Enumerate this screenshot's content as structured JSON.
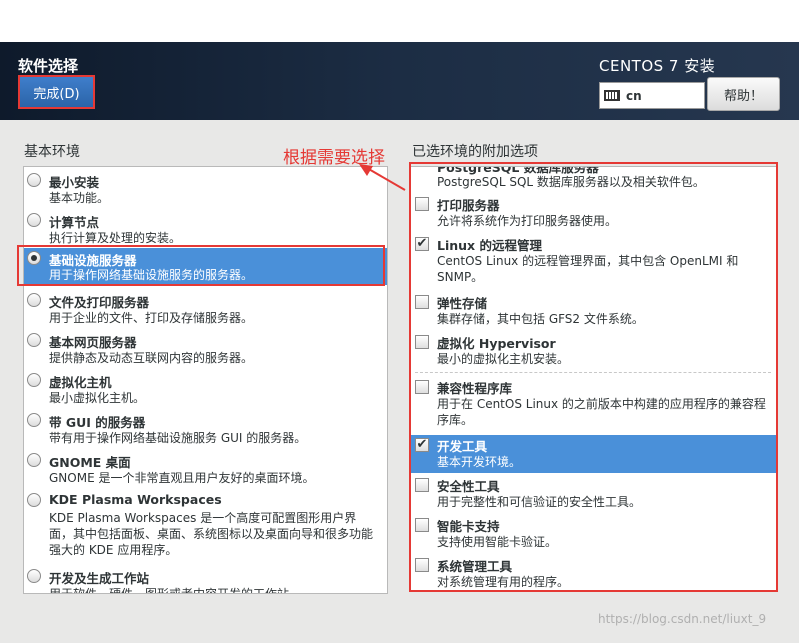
{
  "header": {
    "title": "软件选择",
    "done_label": "完成(D)",
    "product_title": "CENTOS 7 安装",
    "keyboard_layout": "cn",
    "help_label": "帮助！"
  },
  "left": {
    "label": "基本环境",
    "items": [
      {
        "name": "最小安装",
        "desc": "基本功能。",
        "selected": false
      },
      {
        "name": "计算节点",
        "desc": "执行计算及处理的安装。",
        "selected": false
      },
      {
        "name": "基础设施服务器",
        "desc": "用于操作网络基础设施服务的服务器。",
        "selected": true
      },
      {
        "name": "文件及打印服务器",
        "desc": "用于企业的文件、打印及存储服务器。",
        "selected": false
      },
      {
        "name": "基本网页服务器",
        "desc": "提供静态及动态互联网内容的服务器。",
        "selected": false
      },
      {
        "name": "虚拟化主机",
        "desc": "最小虚拟化主机。",
        "selected": false
      },
      {
        "name": "带 GUI 的服务器",
        "desc": "带有用于操作网络基础设施服务 GUI 的服务器。",
        "selected": false
      },
      {
        "name": "GNOME 桌面",
        "desc": "GNOME 是一个非常直观且用户友好的桌面环境。",
        "selected": false
      },
      {
        "name": "KDE Plasma Workspaces",
        "desc": "KDE Plasma Workspaces 是一个高度可配置图形用户界面，其中包括面板、桌面、系统图标以及桌面向导和很多功能强大的 KDE 应用程序。",
        "selected": false
      },
      {
        "name": "开发及生成工作站",
        "desc": "用于软件、硬件、图形或者内容开发的工作站。",
        "selected": false
      }
    ]
  },
  "right": {
    "label": "已选环境的附加选项",
    "cut_name": "PostgreSQL 数据库服务器",
    "cut_desc": "PostgreSQL SQL 数据库服务器以及相关软件包。",
    "items": [
      {
        "name": "打印服务器",
        "desc": "允许将系统作为打印服务器使用。",
        "checked": false,
        "selected": false
      },
      {
        "name": "Linux 的远程管理",
        "desc": "CentOS Linux 的远程管理界面，其中包含 OpenLMI 和 SNMP。",
        "checked": true,
        "selected": false
      },
      {
        "name": "弹性存储",
        "desc": "集群存储，其中包括 GFS2 文件系统。",
        "checked": false,
        "selected": false
      },
      {
        "name": "虚拟化 Hypervisor",
        "desc": "最小的虚拟化主机安装。",
        "checked": false,
        "selected": false
      },
      {
        "name": "兼容性程序库",
        "desc": "用于在 CentOS Linux 的之前版本中构建的应用程序的兼容程序库。",
        "checked": false,
        "selected": false
      },
      {
        "name": "开发工具",
        "desc": "基本开发环境。",
        "checked": true,
        "selected": true
      },
      {
        "name": "安全性工具",
        "desc": "用于完整性和可信验证的安全性工具。",
        "checked": false,
        "selected": false
      },
      {
        "name": "智能卡支持",
        "desc": "支持使用智能卡验证。",
        "checked": false,
        "selected": false
      },
      {
        "name": "系统管理工具",
        "desc": "对系统管理有用的程序。",
        "checked": false,
        "selected": false
      }
    ]
  },
  "annotation": "根据需要选择",
  "watermark": "https://blog.csdn.net/liuxt_9",
  "colors": {
    "accent": "#4a90d9",
    "annotation": "#e53935",
    "header_bg": "#1c2d44"
  }
}
